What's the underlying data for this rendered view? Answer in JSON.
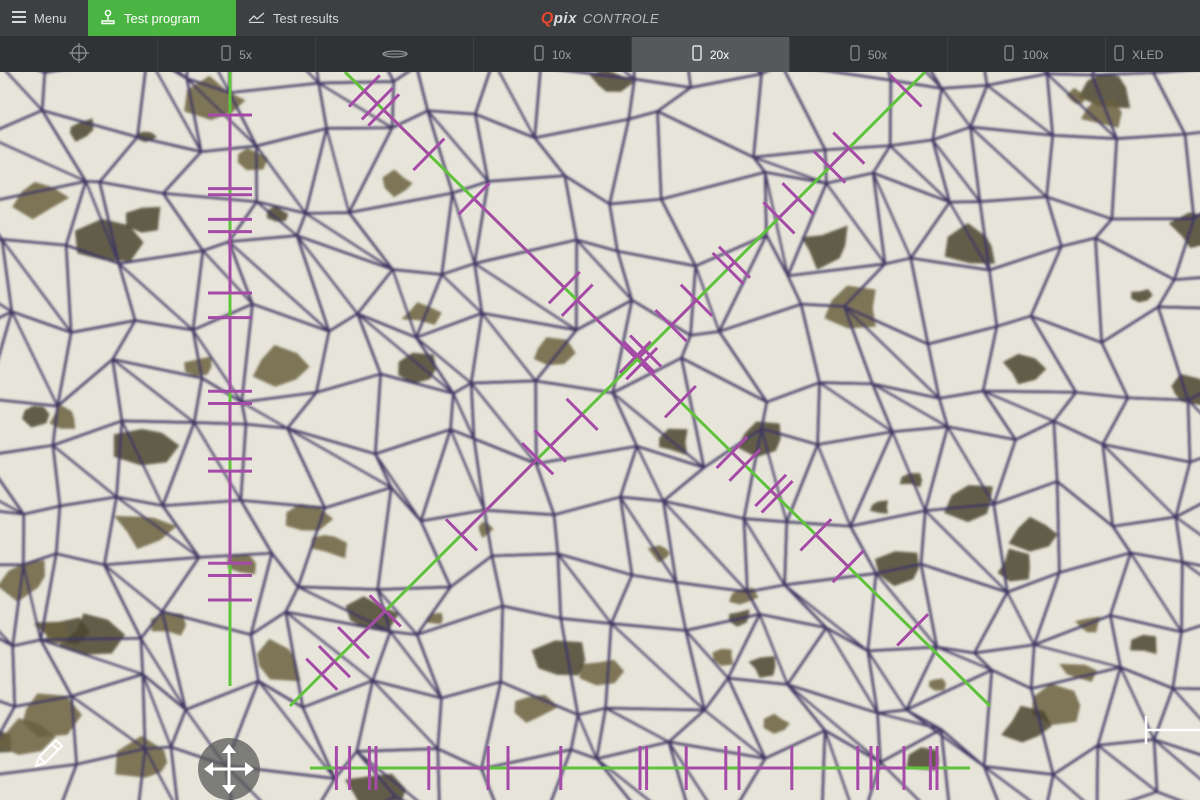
{
  "topbar": {
    "menu_label": "Menu",
    "test_program_label": "Test program",
    "test_results_label": "Test results",
    "brand_q": "Q",
    "brand_pix": "pix",
    "brand_control": "CONTROLE",
    "active_color": "#4bb543"
  },
  "objectives": {
    "items": [
      {
        "label": "",
        "icon": "crosshair-icon"
      },
      {
        "label": "5x",
        "icon": "objective-icon"
      },
      {
        "label": "",
        "icon": "lens-icon"
      },
      {
        "label": "10x",
        "icon": "objective-icon"
      },
      {
        "label": "20x",
        "icon": "objective-icon"
      },
      {
        "label": "50x",
        "icon": "objective-icon"
      },
      {
        "label": "100x",
        "icon": "objective-icon"
      },
      {
        "label": "XLED",
        "icon": "objective-icon"
      }
    ],
    "active": "20x"
  },
  "overlay": {
    "line_color": "#5ec23a",
    "intercept_color": "#a64aa8",
    "tools": [
      "pencil-icon",
      "move-icon",
      "scale-bar-icon"
    ]
  }
}
